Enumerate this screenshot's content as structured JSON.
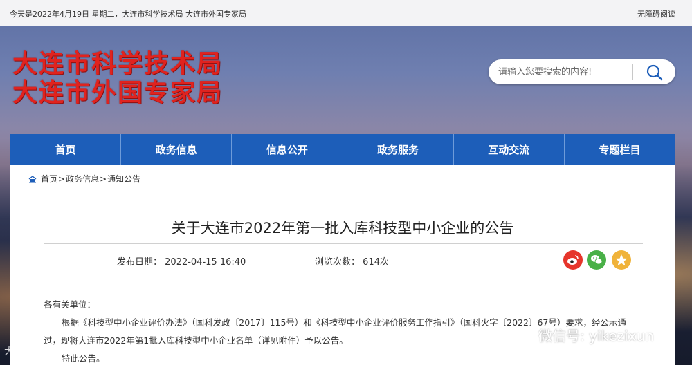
{
  "topbar": {
    "date_text": "今天是2022年4月19日  星期二，大连市科学技术局  大连市外国专家局",
    "accessibility_label": "无障碍阅读"
  },
  "header": {
    "logo_line1": "大连市科学技术局",
    "logo_line2": "大连市外国专家局",
    "logo_color": "#e0231f"
  },
  "search": {
    "placeholder": "请输入您要搜索的内容!",
    "button_icon": "search-icon"
  },
  "nav": {
    "background": "#1d5eb9",
    "items": [
      {
        "label": "首页"
      },
      {
        "label": "政务信息"
      },
      {
        "label": "信息公开"
      },
      {
        "label": "政务服务"
      },
      {
        "label": "互动交流"
      },
      {
        "label": "专题栏目"
      }
    ]
  },
  "breadcrumb": {
    "icon": "home-icon",
    "items": [
      "首页",
      "政务信息",
      "通知公告"
    ],
    "separator": ">"
  },
  "article": {
    "title": "关于大连市2022年第一批入库科技型中小企业的公告",
    "publish_label": "发布日期：",
    "publish_date": "2022-04-15  16:40",
    "views_label": "浏览次数：",
    "views_count": "614次",
    "share_icons": [
      "weibo-icon",
      "wechat-icon",
      "favorite-icon"
    ],
    "salutation": "各有关单位：",
    "paragraph1": "根据《科技型中小企业评价办法》（国科发政〔2017〕115号）和《科技型中小企业评价服务工作指引》（国科火字〔2022〕67号）要求，经公示通过，现将大连市2022年第1批入库科技型中小企业名单（详见附件）予以公告。",
    "paragraph2": "特此公告。"
  },
  "watermarks": {
    "left": "大数跨境",
    "right": "微信号: yikezixun"
  }
}
